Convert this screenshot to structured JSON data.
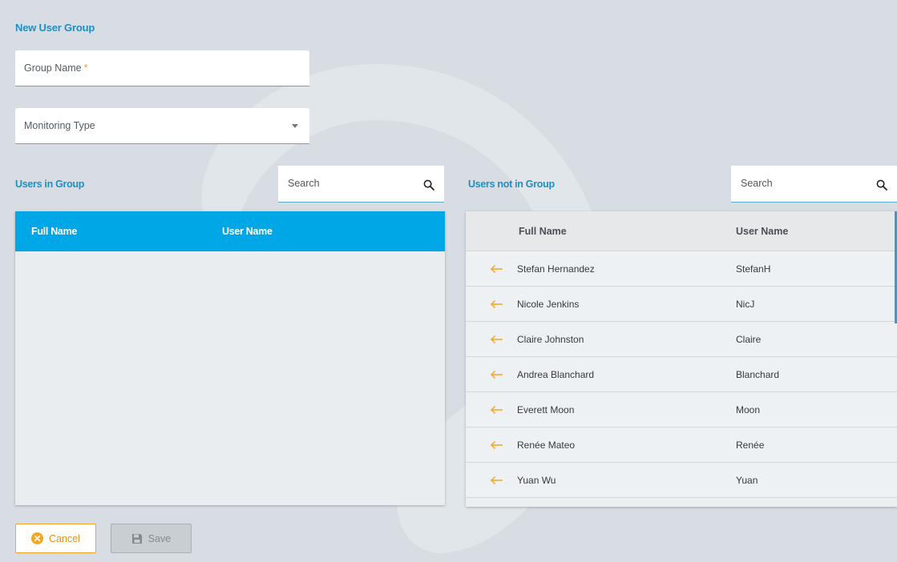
{
  "form": {
    "title": "New User Group",
    "group_name_label": "Group Name",
    "required_mark": "*",
    "monitoring_type_label": "Monitoring Type"
  },
  "left": {
    "title": "Users in Group",
    "search_placeholder": "Search",
    "columns": [
      "Full Name",
      "User Name"
    ]
  },
  "right": {
    "title": "Users not in Group",
    "search_placeholder": "Search",
    "columns": [
      "Full Name",
      "User Name"
    ],
    "rows": [
      {
        "full_name": "Stefan Hernandez",
        "user_name": "StefanH"
      },
      {
        "full_name": "Nicole Jenkins",
        "user_name": "NicJ"
      },
      {
        "full_name": "Claire Johnston",
        "user_name": "Claire"
      },
      {
        "full_name": "Andrea Blanchard",
        "user_name": "Blanchard"
      },
      {
        "full_name": "Everett Moon",
        "user_name": "Moon"
      },
      {
        "full_name": "Renée Mateo",
        "user_name": "Renée"
      },
      {
        "full_name": "Yuan Wu",
        "user_name": "Yuan"
      }
    ]
  },
  "actions": {
    "cancel_label": "Cancel",
    "save_label": "Save"
  },
  "colors": {
    "accent": "#1d8fc4",
    "header_blue": "#00a7e6",
    "orange": "#f5a425"
  },
  "icons": {
    "search": "search-icon",
    "add_row": "arrow-left-icon",
    "cancel": "cancel-circle-icon",
    "save": "floppy-disk-icon"
  }
}
